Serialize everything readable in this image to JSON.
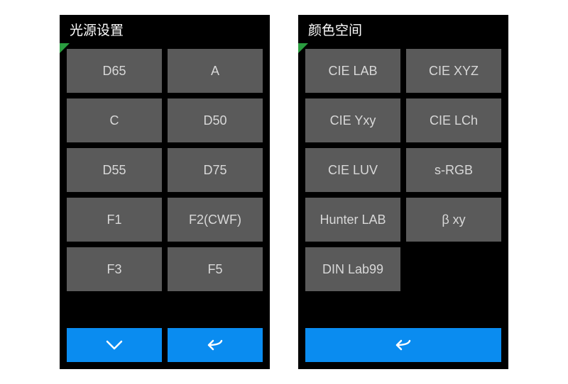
{
  "panels": [
    {
      "title": "光源设置",
      "buttons": [
        {
          "label": "D65"
        },
        {
          "label": "A"
        },
        {
          "label": "C"
        },
        {
          "label": "D50"
        },
        {
          "label": "D55"
        },
        {
          "label": "D75"
        },
        {
          "label": "F1"
        },
        {
          "label": "F2(CWF)"
        },
        {
          "label": "F3"
        },
        {
          "label": "F5"
        }
      ],
      "footer": [
        "down",
        "back"
      ]
    },
    {
      "title": "颜色空间",
      "buttons": [
        {
          "label": "CIE LAB"
        },
        {
          "label": "CIE XYZ"
        },
        {
          "label": "CIE Yxy"
        },
        {
          "label": "CIE LCh"
        },
        {
          "label": "CIE LUV"
        },
        {
          "label": "s-RGB"
        },
        {
          "label": "Hunter LAB"
        },
        {
          "label": "β xy"
        },
        {
          "label": "DIN Lab99"
        }
      ],
      "footer": [
        "back"
      ]
    }
  ],
  "colors": {
    "panel_bg": "#000000",
    "cell_bg": "#5a5a5a",
    "cell_fg": "#d8d8d8",
    "accent": "#0a8cf0",
    "indicator": "#2a9d3f"
  }
}
